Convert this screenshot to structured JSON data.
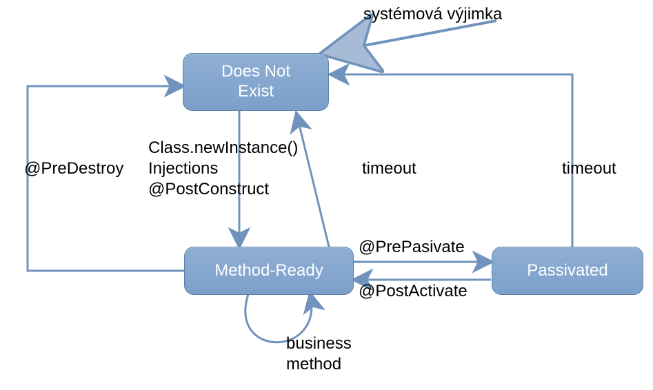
{
  "nodes": {
    "doesNotExist": "Does Not\nExist",
    "methodReady": "Method-Ready",
    "passivated": "Passivated"
  },
  "labels": {
    "systemException": "systémová výjimka",
    "preDestroy": "@PreDestroy",
    "newInstance": "Class.newInstance()\nInjections\n@PostConstruct",
    "timeout1": "timeout",
    "timeout2": "timeout",
    "prePassivate": "@PrePasivate",
    "postActivate": "@PostActivate",
    "businessMethod": "business\nmethod"
  },
  "colors": {
    "stroke": "#6f93bd",
    "fill": "#8faed3"
  }
}
